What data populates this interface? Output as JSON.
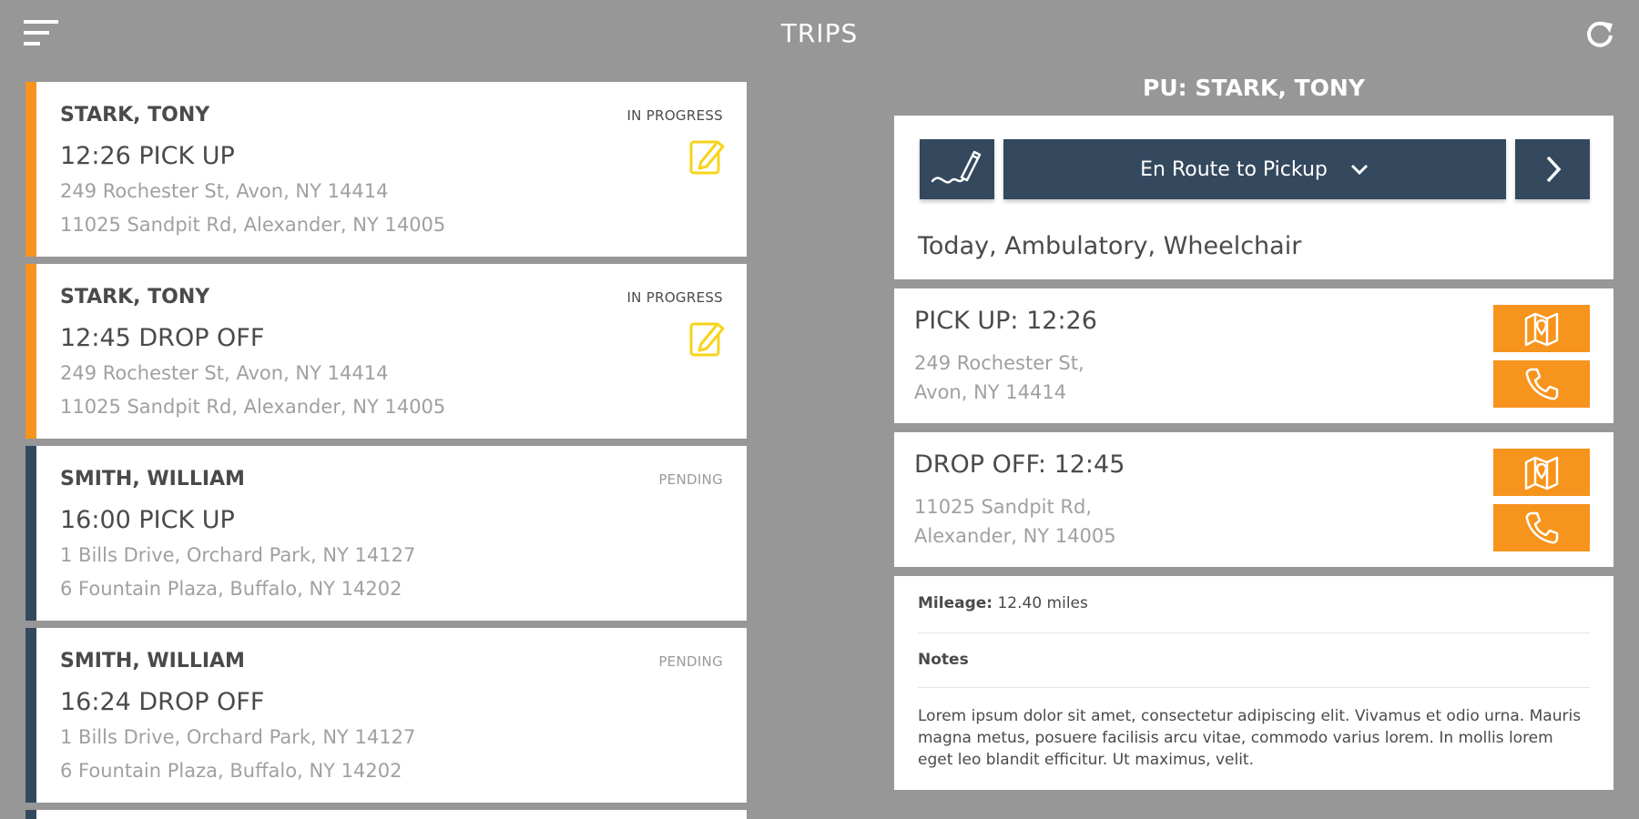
{
  "header": {
    "title": "TRIPS",
    "menu_icon": "menu-icon",
    "refresh_icon": "refresh-icon"
  },
  "colors": {
    "background": "#979797",
    "in_progress_accent": "#f7941d",
    "pending_accent": "#34495e",
    "edit_icon": "#f8d31c",
    "action_button": "#34495e",
    "contact_button": "#f7941d"
  },
  "trips": [
    {
      "name": "STARK, TONY",
      "status": "IN PROGRESS",
      "event": "12:26 PICK UP",
      "address_1": "249 Rochester St, Avon, NY 14414",
      "address_2": "11025 Sandpit Rd, Alexander, NY 14005",
      "state": "in-progress",
      "icon": "edit-icon"
    },
    {
      "name": "STARK, TONY",
      "status": "IN PROGRESS",
      "event": "12:45 DROP OFF",
      "address_1": "249 Rochester St, Avon, NY 14414",
      "address_2": "11025 Sandpit Rd, Alexander, NY 14005",
      "state": "in-progress",
      "icon": "edit-icon"
    },
    {
      "name": "SMITH, WILLIAM",
      "status": "PENDING",
      "event": "16:00 PICK UP",
      "address_1": "1 Bills Drive, Orchard Park, NY 14127",
      "address_2": "6 Fountain Plaza, Buffalo, NY 14202",
      "state": "pending"
    },
    {
      "name": "SMITH, WILLIAM",
      "status": "PENDING",
      "event": "16:24 DROP OFF",
      "address_1": "1 Bills Drive, Orchard Park, NY 14127",
      "address_2": "6 Fountain Plaza, Buffalo, NY 14202",
      "state": "pending"
    }
  ],
  "detail": {
    "title": "PU: STARK, TONY",
    "sign_icon": "signature-icon",
    "status_select": "En Route to Pickup",
    "next_icon": "chevron-right-icon",
    "tags": "Today, Ambulatory, Wheelchair",
    "pickup": {
      "title": "PICK UP: 12:26",
      "line_1": "249 Rochester St,",
      "line_2": "Avon, NY 14414"
    },
    "dropoff": {
      "title": "DROP OFF: 12:45",
      "line_1": "11025 Sandpit Rd,",
      "line_2": "Alexander, NY 14005"
    },
    "mileage_label": "Mileage:",
    "mileage_value": "12.40 miles",
    "notes_label": "Notes",
    "notes_text": "Lorem ipsum dolor sit amet, consectetur adipiscing elit. Vivamus et odio urna. Mauris magna metus, posuere facilisis arcu vitae, commodo varius lorem. In mollis lorem eget leo blandit efficitur. Ut maximus, velit."
  }
}
